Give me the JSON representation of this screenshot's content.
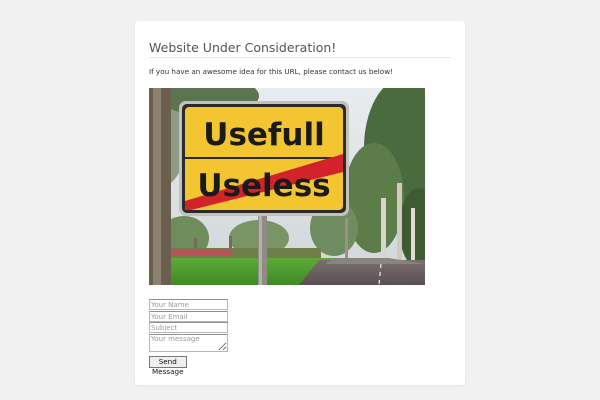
{
  "page": {
    "title": "Website Under Consideration!",
    "intro": "If you have an awesome idea for this URL, please contact us below!"
  },
  "hero_image": {
    "description_icon": "road-sign-photo",
    "sign_top_text": "Usefull",
    "sign_bottom_text": "Useless"
  },
  "form": {
    "name_placeholder": "Your Name",
    "email_placeholder": "Your Email",
    "subject_placeholder": "Subject",
    "message_placeholder": "Your message",
    "send_label": "Send Message"
  },
  "colors": {
    "background": "#f1f1f1",
    "card": "#ffffff",
    "sign_yellow": "#f2c531",
    "sign_red_stripe": "#d3232a",
    "grass": "#4f9a2e"
  }
}
